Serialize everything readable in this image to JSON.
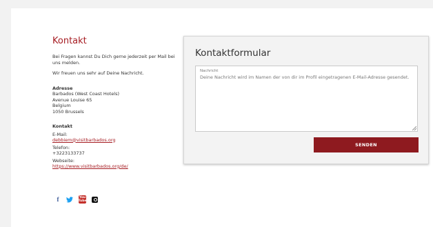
{
  "contact_info": {
    "heading": "Kontakt",
    "intro": "Bei Fragen kannst Du Dich gerne jederzeit per Mail bei uns melden.",
    "thanks": "Wir freuen uns sehr auf Deine Nachricht.",
    "address_heading": "Adresse",
    "address_lines": [
      "Barbados (West Coast Hotels)",
      "Avenue Louise 65",
      "Belgium",
      "1050 Brussels"
    ],
    "kontakt_heading": "Kontakt",
    "email_label": "E-Mail:",
    "email": "debbiem@visitbarbados.org",
    "phone_label": "Telefon:",
    "phone": "+3223133737",
    "website_label": "Webseite:",
    "website": "https://www.visitbarbados.org/de/"
  },
  "social": {
    "facebook": "f",
    "twitter": "🐦",
    "youtube_top": "You",
    "youtube_bottom": "Tube"
  },
  "form": {
    "title": "Kontaktformular",
    "message_label": "Nachricht",
    "message_placeholder": "Deine Nachricht wird im Namen der von dir im Profil eingetragenen E-Mail-Adresse gesendet.",
    "submit_label": "SENDEN"
  },
  "colors": {
    "accent": "#a61c22",
    "button": "#8e1a1f"
  }
}
